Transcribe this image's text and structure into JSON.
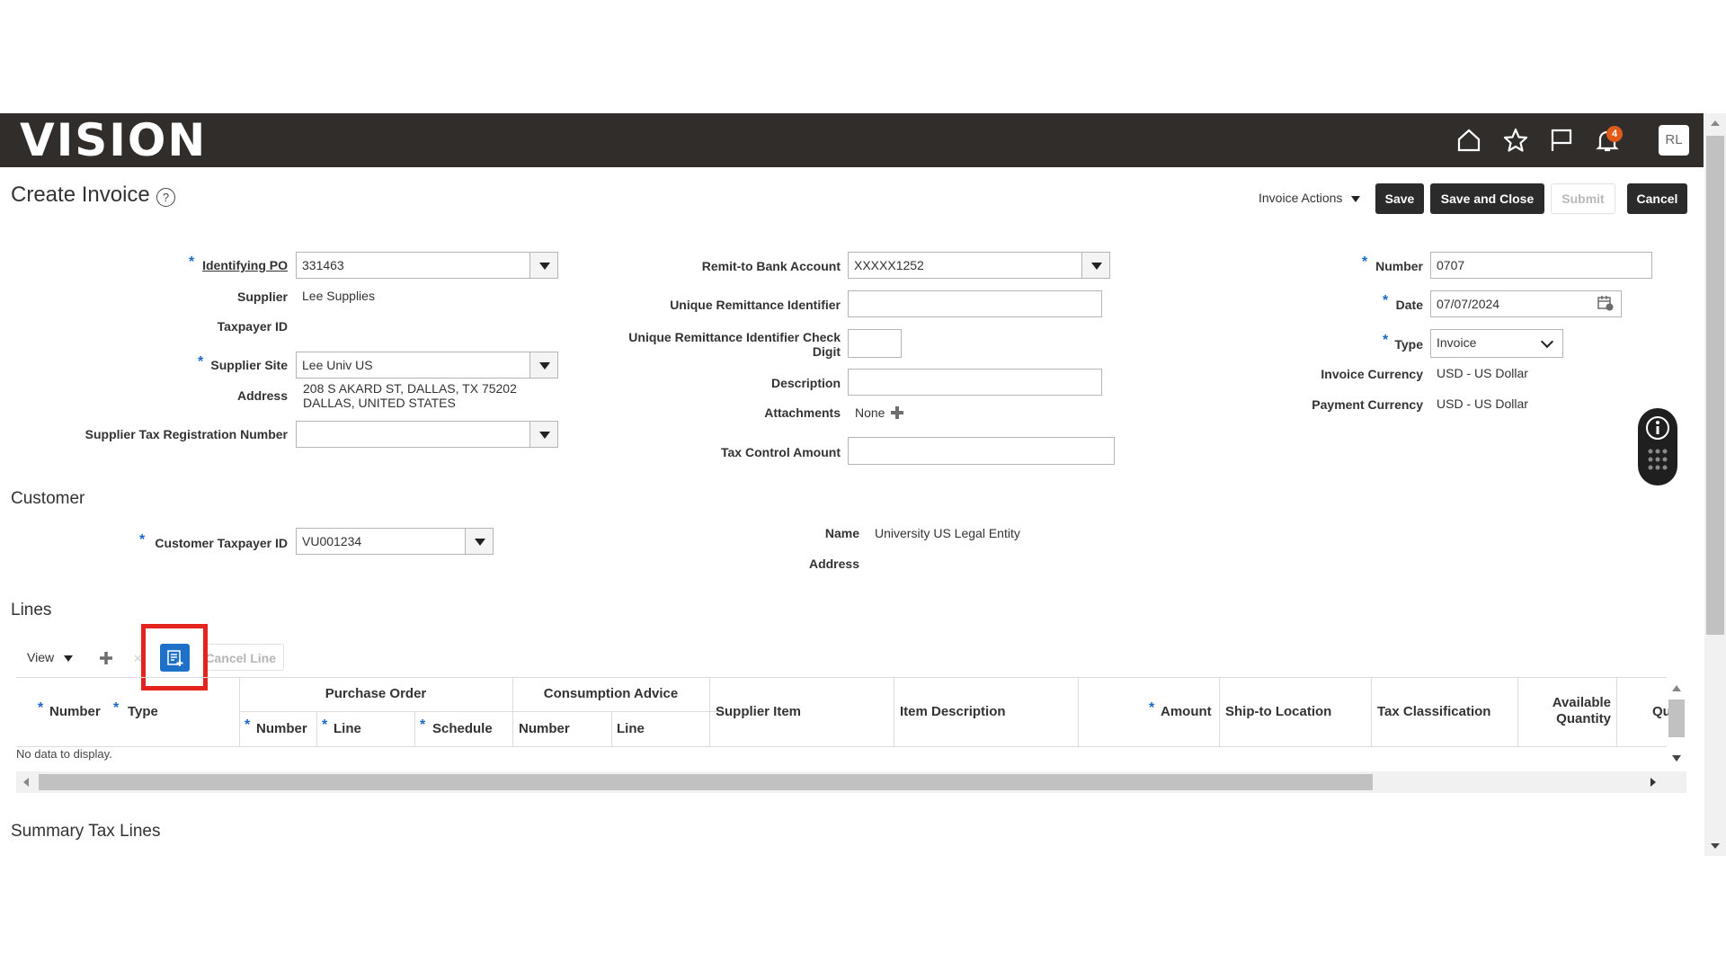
{
  "header": {
    "logo": "VISION",
    "notification_count": "4",
    "avatar_initials": "RL",
    "icons": [
      "home-icon",
      "star-icon",
      "flag-icon",
      "bell-icon"
    ]
  },
  "page": {
    "title": "Create Invoice",
    "help_symbol": "?"
  },
  "toolbar": {
    "invoice_actions": "Invoice Actions",
    "save": "Save",
    "save_and_close": "Save and Close",
    "submit": "Submit",
    "cancel": "Cancel"
  },
  "invoice": {
    "identifying_po_label": "Identifying PO",
    "identifying_po": "331463",
    "supplier_label": "Supplier",
    "supplier": "Lee Supplies",
    "taxpayer_id_label": "Taxpayer ID",
    "supplier_site_label": "Supplier Site",
    "supplier_site": "Lee Univ US",
    "address_label": "Address",
    "address_line1": "208 S AKARD ST, DALLAS, TX 75202",
    "address_line2": "DALLAS, UNITED STATES",
    "supplier_tax_reg_label": "Supplier Tax Registration Number",
    "supplier_tax_reg": "",
    "remit_bank_label": "Remit-to Bank Account",
    "remit_bank": "XXXXX1252",
    "unique_remit_label": "Unique Remittance Identifier",
    "unique_remit": "",
    "unique_remit_check_label_1": "Unique Remittance Identifier Check",
    "unique_remit_check_label_2": "Digit",
    "description_label": "Description",
    "description": "",
    "attachments_label": "Attachments",
    "attachments": "None",
    "tax_control_label": "Tax Control Amount",
    "tax_control": "",
    "number_label": "Number",
    "number": "0707",
    "date_label": "Date",
    "date": "07/07/2024",
    "type_label": "Type",
    "type": "Invoice",
    "invoice_currency_label": "Invoice Currency",
    "invoice_currency": "USD - US Dollar",
    "payment_currency_label": "Payment Currency",
    "payment_currency": "USD - US Dollar"
  },
  "customer": {
    "section_title": "Customer",
    "taxpayer_label": "Customer Taxpayer ID",
    "taxpayer": "VU001234",
    "name_label": "Name",
    "name": "University US Legal Entity",
    "address_label": "Address"
  },
  "lines": {
    "section_title": "Lines",
    "view_label": "View",
    "cancel_line": "Cancel Line",
    "headers": {
      "number": "Number",
      "type": "Type",
      "purchase_order": "Purchase Order",
      "po_number": "Number",
      "po_line": "Line",
      "po_schedule": "Schedule",
      "consumption_advice": "Consumption Advice",
      "ca_number": "Number",
      "ca_line": "Line",
      "supplier_item": "Supplier Item",
      "item_description": "Item Description",
      "amount": "Amount",
      "ship_to": "Ship-to Location",
      "tax_class": "Tax Classification",
      "available_qty_1": "Available",
      "available_qty_2": "Quantity",
      "qty_partial": "Qu"
    },
    "empty_text": "No data to display."
  },
  "summary_tax": {
    "section_title": "Summary Tax Lines"
  }
}
